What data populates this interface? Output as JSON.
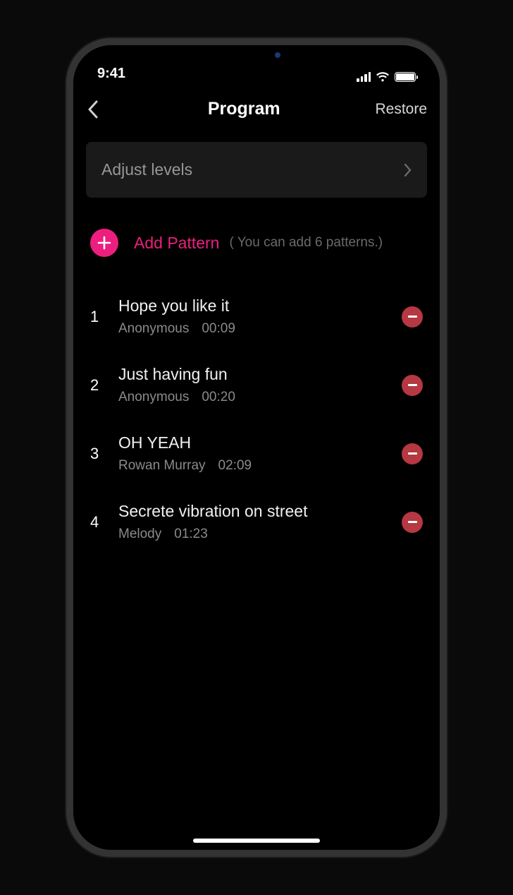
{
  "status": {
    "time": "9:41"
  },
  "nav": {
    "title": "Program",
    "restore": "Restore"
  },
  "adjust": {
    "label": "Adjust levels"
  },
  "add": {
    "label": "Add Pattern",
    "hint": "( You can add 6 patterns.)"
  },
  "patterns": [
    {
      "num": "1",
      "title": "Hope you like it",
      "author": "Anonymous",
      "duration": "00:09"
    },
    {
      "num": "2",
      "title": "Just having fun",
      "author": "Anonymous",
      "duration": "00:20"
    },
    {
      "num": "3",
      "title": "OH YEAH",
      "author": "Rowan Murray",
      "duration": "02:09"
    },
    {
      "num": "4",
      "title": "Secrete vibration on street",
      "author": "Melody",
      "duration": "01:23"
    }
  ]
}
